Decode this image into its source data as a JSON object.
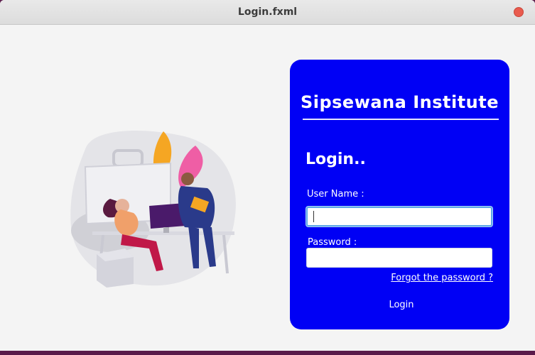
{
  "window": {
    "title": "Login.fxml"
  },
  "panel": {
    "brand": "Sipsewana Institute",
    "heading": "Login..",
    "username_label": "User Name :",
    "username_value": "",
    "password_label": "Password :",
    "password_value": "",
    "forgot_link": "Forgot the password ?",
    "login_button": "Login"
  },
  "colors": {
    "panel_bg": "#0000f5",
    "field_focus": "#5fa8e8",
    "close_button": "#e95b4e"
  },
  "icons": [
    "close-icon",
    "office-illustration"
  ]
}
